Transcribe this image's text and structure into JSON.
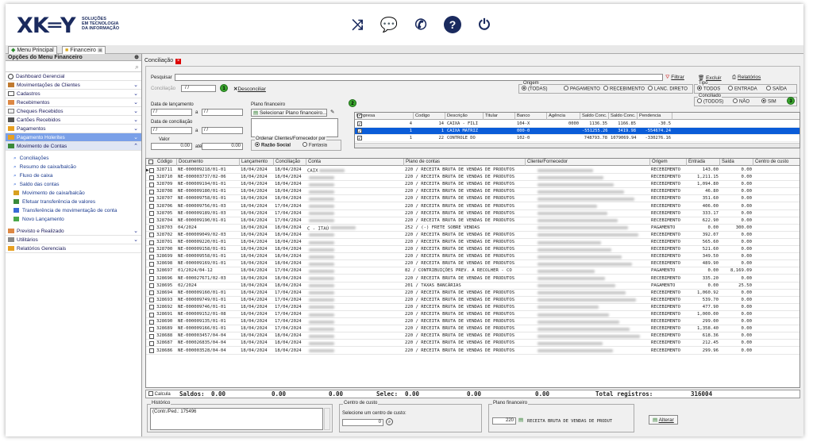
{
  "brand": {
    "logo": "XK═Y",
    "tagline": [
      "SOLUÇÕES",
      "EM TECNOLOGIA",
      "DA INFORMAÇÃO"
    ]
  },
  "top_icons": [
    "shuffle-icon",
    "chat-icon",
    "whatsapp-icon",
    "help-icon",
    "power-icon"
  ],
  "app_tabs": [
    "Menu Principal",
    "Financeiro"
  ],
  "sidebar": {
    "title": "Opções do Menu Financeiro",
    "items": [
      {
        "label": "Dashboard Gerencial",
        "chev": false
      },
      {
        "label": "Movimentações de Clientes",
        "chev": true
      },
      {
        "label": "Cadastros",
        "chev": true
      },
      {
        "label": "Recebimentos",
        "chev": true
      },
      {
        "label": "Cheques Recebidos",
        "chev": true
      },
      {
        "label": "Cartões Recebidos",
        "chev": true
      },
      {
        "label": "Pagamentos",
        "chev": true
      },
      {
        "label": "Pagamento Holerites",
        "chev": true
      },
      {
        "label": "Movimento de Contas",
        "chev": true
      }
    ],
    "subitems": [
      "Conciliações",
      "Resumo de caixa/balcão",
      "Fluxo de caixa",
      "Saldo das contas",
      "Movimento de caixa/balcão",
      "Efetuar transferência de valores",
      "Transferência de movimentação de conta",
      "Novo Lançamento"
    ],
    "footer_items": [
      "Previsto e Realizado",
      "Utilitários",
      "Relatórios Gerenciais"
    ]
  },
  "screen_tab": "Conciliação",
  "filters": {
    "pesquisar_label": "Pesquisar",
    "conciliacao_label": "Conciliação",
    "conciliacao_value": "/ /",
    "desconciliar_label": "Desconciliar",
    "data_lancamento_label": "Data de lançamento",
    "data_conciliacao_label": "Data de conciliação",
    "date_sep": "a",
    "date_empty": "/ /",
    "valor_label": "Valor",
    "valor_from": "0.00",
    "valor_ate_label": "até",
    "valor_to": "0.00",
    "plano_label": "Plano financeiro",
    "plano_button": "Selecionar Plano financeiro...",
    "ordenar_label": "Ordenar Clientes/Fornecedor por",
    "ordenar_options": [
      "Razão Social",
      "Fantasia"
    ],
    "filtrar": "Filtrar",
    "excluir": "Excluir",
    "relatorios": "Relatórios",
    "origem_label": "Origem",
    "origem_options": [
      "(TODAS)",
      "PAGAMENTO",
      "RECEBIMENTO",
      "LANC. DIRETO"
    ],
    "tipo_label": "Tipo",
    "tipo_options": [
      "TODOS",
      "ENTRADA",
      "SAÍDA"
    ],
    "conciliado_label": "Conciliado",
    "conciliado_options": [
      "(TODOS)",
      "NÃO",
      "SIM"
    ],
    "badges": [
      "1",
      "2",
      "3"
    ]
  },
  "accounts": {
    "headers": [
      "Empresa",
      "Codigo",
      "Descrição",
      "Titular",
      "Banco",
      "Agência",
      "Saldo Conc.",
      "Saldo Conc.",
      "Pendencia"
    ],
    "rows": [
      {
        "empresa": "4",
        "codigo": "14",
        "descricao": "CAIXA - FILI",
        "titular": "",
        "banco": "104-X",
        "agencia": "0000",
        "s1": "1136.35",
        "s2": "1166.85",
        "pend": "-30.5",
        "sel": false
      },
      {
        "empresa": "1",
        "codigo": "1",
        "descricao": "CAIXA MATRIZ",
        "titular": "",
        "banco": "000-0",
        "agencia": "",
        "s1": "-551255.26",
        "s2": "3419.98",
        "pend": "-554674.24",
        "sel": true
      },
      {
        "empresa": "1",
        "codigo": "22",
        "descricao": "CONTROLE DO",
        "titular": "",
        "banco": "102-0",
        "agencia": "",
        "s1": "748793.78",
        "s2": "1079069.94",
        "pend": "-330276.16",
        "sel": false
      }
    ]
  },
  "grid": {
    "headers": [
      "Código",
      "Documento",
      "Lançamento",
      "Conciliação",
      "Conta",
      "Plano de contas",
      "Cliente/Fornecedor",
      "Origem",
      "Entrada",
      "Saída",
      "Centro de custo"
    ],
    "rows": [
      {
        "codigo": "328711",
        "doc": "NE-000009218/01-01",
        "lanc": "18/04/2024",
        "conc": "18/04/2024",
        "conta": "CAIX",
        "plano": "220 / RECEITA BRUTA DE VENDAS DE PRODUTOS",
        "origem": "RECEBIMENTO",
        "entrada": "143.00",
        "saida": "0.00"
      },
      {
        "codigo": "328710",
        "doc": "NE-000003737/02-06",
        "lanc": "18/04/2024",
        "conc": "18/04/2024",
        "conta": "",
        "plano": "220 / RECEITA BRUTA DE VENDAS DE PRODUTOS",
        "origem": "RECEBIMENTO",
        "entrada": "1,211.15",
        "saida": "0.00"
      },
      {
        "codigo": "328709",
        "doc": "NE-000009194/01-01",
        "lanc": "18/04/2024",
        "conc": "18/04/2024",
        "conta": "",
        "plano": "220 / RECEITA BRUTA DE VENDAS DE PRODUTOS",
        "origem": "RECEBIMENTO",
        "entrada": "1,094.80",
        "saida": "0.00"
      },
      {
        "codigo": "328708",
        "doc": "NE-000009180/01-01",
        "lanc": "18/04/2024",
        "conc": "18/04/2024",
        "conta": "",
        "plano": "220 / RECEITA BRUTA DE VENDAS DE PRODUTOS",
        "origem": "RECEBIMENTO",
        "entrada": "46.80",
        "saida": "0.00"
      },
      {
        "codigo": "328707",
        "doc": "NE-000009758/01-01",
        "lanc": "18/04/2024",
        "conc": "18/04/2024",
        "conta": "",
        "plano": "220 / RECEITA BRUTA DE VENDAS DE PRODUTOS",
        "origem": "RECEBIMENTO",
        "entrada": "351.60",
        "saida": "0.00"
      },
      {
        "codigo": "328706",
        "doc": "NE-000009756/01-03",
        "lanc": "18/04/2024",
        "conc": "17/04/2024",
        "conta": "",
        "plano": "220 / RECEITA BRUTA DE VENDAS DE PRODUTOS",
        "origem": "RECEBIMENTO",
        "entrada": "406.00",
        "saida": "0.00"
      },
      {
        "codigo": "328705",
        "doc": "NE-000009189/01-03",
        "lanc": "18/04/2024",
        "conc": "17/04/2024",
        "conta": "",
        "plano": "220 / RECEITA BRUTA DE VENDAS DE PRODUTOS",
        "origem": "RECEBIMENTO",
        "entrada": "333.17",
        "saida": "0.00"
      },
      {
        "codigo": "328704",
        "doc": "NE-000009190/01-01",
        "lanc": "18/04/2024",
        "conc": "17/04/2024",
        "conta": "",
        "plano": "220 / RECEITA BRUTA DE VENDAS DE PRODUTOS",
        "origem": "RECEBIMENTO",
        "entrada": "622.90",
        "saida": "0.00"
      },
      {
        "codigo": "328703",
        "doc": "04/2024",
        "lanc": "18/04/2024",
        "conc": "18/04/2024",
        "conta": "C - ITAÚ",
        "plano": "252 / (-) FRETE SOBRE VENDAS",
        "origem": "PAGAMENTO",
        "entrada": "0.00",
        "saida": "300.00"
      },
      {
        "codigo": "328702",
        "doc": "NE-000009049/02-03",
        "lanc": "18/04/2024",
        "conc": "18/04/2024",
        "conta": "",
        "plano": "220 / RECEITA BRUTA DE VENDAS DE PRODUTOS",
        "origem": "RECEBIMENTO",
        "entrada": "392.07",
        "saida": "0.00"
      },
      {
        "codigo": "328701",
        "doc": "NE-000009220/01-01",
        "lanc": "18/04/2024",
        "conc": "18/04/2024",
        "conta": "",
        "plano": "220 / RECEITA BRUTA DE VENDAS DE PRODUTOS",
        "origem": "RECEBIMENTO",
        "entrada": "565.60",
        "saida": "0.00"
      },
      {
        "codigo": "328700",
        "doc": "NE-000009158/01-01",
        "lanc": "18/04/2024",
        "conc": "18/04/2024",
        "conta": "",
        "plano": "220 / RECEITA BRUTA DE VENDAS DE PRODUTOS",
        "origem": "RECEBIMENTO",
        "entrada": "521.60",
        "saida": "0.00"
      },
      {
        "codigo": "328699",
        "doc": "NE-000009558/01-01",
        "lanc": "18/04/2024",
        "conc": "18/04/2024",
        "conta": "",
        "plano": "220 / RECEITA BRUTA DE VENDAS DE PRODUTOS",
        "origem": "RECEBIMENTO",
        "entrada": "349.50",
        "saida": "0.00"
      },
      {
        "codigo": "328698",
        "doc": "NE-000009169/01-01",
        "lanc": "18/04/2024",
        "conc": "18/04/2024",
        "conta": "",
        "plano": "220 / RECEITA BRUTA DE VENDAS DE PRODUTOS",
        "origem": "RECEBIMENTO",
        "entrada": "489.90",
        "saida": "0.00"
      },
      {
        "codigo": "328697",
        "doc": "01/2024/04-12",
        "lanc": "18/04/2024",
        "conc": "17/04/2024",
        "conta": "",
        "plano": "82 / CONTRIBUIÇÕES PREV. A RECOLHER - CO",
        "origem": "PAGAMENTO",
        "entrada": "0.00",
        "saida": "8,169.09"
      },
      {
        "codigo": "328696",
        "doc": "NE-000027671/02-03",
        "lanc": "18/04/2024",
        "conc": "18/04/2024",
        "conta": "",
        "plano": "220 / RECEITA BRUTA DE VENDAS DE PRODUTOS",
        "origem": "RECEBIMENTO",
        "entrada": "335.20",
        "saida": "0.00"
      },
      {
        "codigo": "328695",
        "doc": "02/2024",
        "lanc": "18/04/2024",
        "conc": "18/04/2024",
        "conta": "",
        "plano": "201 / TAXAS BANCÁRIAS",
        "origem": "PAGAMENTO",
        "entrada": "0.00",
        "saida": "25.50"
      },
      {
        "codigo": "328694",
        "doc": "NE-000009160/01-01",
        "lanc": "18/04/2024",
        "conc": "17/04/2024",
        "conta": "",
        "plano": "220 / RECEITA BRUTA DE VENDAS DE PRODUTOS",
        "origem": "RECEBIMENTO",
        "entrada": "1,060.92",
        "saida": "0.00"
      },
      {
        "codigo": "328693",
        "doc": "NE-000009749/01-01",
        "lanc": "18/04/2024",
        "conc": "17/04/2024",
        "conta": "",
        "plano": "220 / RECEITA BRUTA DE VENDAS DE PRODUTOS",
        "origem": "RECEBIMENTO",
        "entrada": "539.70",
        "saida": "0.00"
      },
      {
        "codigo": "328692",
        "doc": "NE-000009746/01-01",
        "lanc": "18/04/2024",
        "conc": "17/04/2024",
        "conta": "",
        "plano": "220 / RECEITA BRUTA DE VENDAS DE PRODUTOS",
        "origem": "RECEBIMENTO",
        "entrada": "477.90",
        "saida": "0.00"
      },
      {
        "codigo": "328691",
        "doc": "NE-000009152/01-08",
        "lanc": "18/04/2024",
        "conc": "17/04/2024",
        "conta": "",
        "plano": "220 / RECEITA BRUTA DE VENDAS DE PRODUTOS",
        "origem": "RECEBIMENTO",
        "entrada": "1,000.00",
        "saida": "0.00"
      },
      {
        "codigo": "328690",
        "doc": "NE-000009135/01-01",
        "lanc": "18/04/2024",
        "conc": "17/04/2024",
        "conta": "",
        "plano": "220 / RECEITA BRUTA DE VENDAS DE PRODUTOS",
        "origem": "RECEBIMENTO",
        "entrada": "299.00",
        "saida": "0.00"
      },
      {
        "codigo": "328689",
        "doc": "NE-000009166/01-01",
        "lanc": "18/04/2024",
        "conc": "17/04/2024",
        "conta": "",
        "plano": "220 / RECEITA BRUTA DE VENDAS DE PRODUTOS",
        "origem": "RECEBIMENTO",
        "entrada": "1,358.40",
        "saida": "0.00"
      },
      {
        "codigo": "328688",
        "doc": "NE-000003457/04-04",
        "lanc": "18/04/2024",
        "conc": "18/04/2024",
        "conta": "",
        "plano": "220 / RECEITA BRUTA DE VENDAS DE PRODUTOS",
        "origem": "RECEBIMENTO",
        "entrada": "618.36",
        "saida": "0.00"
      },
      {
        "codigo": "328687",
        "doc": "NE-000026835/04-04",
        "lanc": "18/04/2024",
        "conc": "18/04/2024",
        "conta": "",
        "plano": "220 / RECEITA BRUTA DE VENDAS DE PRODUTOS",
        "origem": "RECEBIMENTO",
        "entrada": "212.45",
        "saida": "0.00"
      },
      {
        "codigo": "328686",
        "doc": "NE-000003528/04-04",
        "lanc": "18/04/2024",
        "conc": "18/04/2024",
        "conta": "",
        "plano": "220 / RECEITA BRUTA DE VENDAS DE PRODUTOS",
        "origem": "RECEBIMENTO",
        "entrada": "299.96",
        "saida": "0.00"
      }
    ]
  },
  "totals": {
    "calcula_label": "Calcula",
    "saldos_label": "Saldos:",
    "saldos_values": [
      "0.00",
      "0.00",
      "0.00"
    ],
    "selec_label": "Selec:",
    "selec_values": [
      "0.00",
      "0.00",
      "0.00"
    ],
    "total_label": "Total registros:",
    "total_value": "316004"
  },
  "bottom": {
    "historico_label": "Histórico",
    "historico_value": "(Contr./Ped.: 175496",
    "centro_label": "Centro de custo",
    "centro_hint": "Selecione um centro de custo:",
    "centro_value": "0",
    "plano_label": "Plano financeiro",
    "plano_code": "220",
    "plano_desc": "RECEITA BRUTA DE VENDAS DE PRODUT",
    "alterar": "Alterar"
  }
}
